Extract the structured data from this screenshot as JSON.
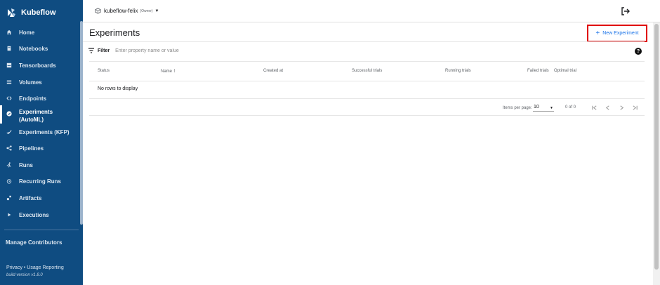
{
  "brand": {
    "name": "Kubeflow"
  },
  "sidebar": {
    "items": [
      {
        "label": "Home",
        "icon": "home-icon"
      },
      {
        "label": "Notebooks",
        "icon": "notebook-icon"
      },
      {
        "label": "Tensorboards",
        "icon": "tensorboard-icon"
      },
      {
        "label": "Volumes",
        "icon": "volume-icon"
      },
      {
        "label": "Endpoints",
        "icon": "endpoints-icon"
      },
      {
        "label": "Experiments\n(AutoML)",
        "icon": "check-circle-icon",
        "active": true
      },
      {
        "label": "Experiments (KFP)",
        "icon": "check-icon"
      },
      {
        "label": "Pipelines",
        "icon": "pipelines-icon"
      },
      {
        "label": "Runs",
        "icon": "runs-icon"
      },
      {
        "label": "Recurring Runs",
        "icon": "alarm-icon"
      },
      {
        "label": "Artifacts",
        "icon": "artifacts-icon"
      },
      {
        "label": "Executions",
        "icon": "play-icon"
      }
    ],
    "manage_contributors": "Manage Contributors",
    "footer_links": "Privacy  •  Usage Reporting",
    "build_version": "build version v1.8.0"
  },
  "topbar": {
    "namespace": "kubeflow-felix",
    "namespace_role": "(Owner)"
  },
  "page": {
    "title": "Experiments",
    "new_button": "New Experiment",
    "filter_label": "Filter",
    "filter_placeholder": "Enter property name or value",
    "columns": [
      "Status",
      "Name",
      "Created at",
      "Successful trials",
      "Running trials",
      "Failed trials",
      "Optimal trial"
    ],
    "empty_message": "No rows to display",
    "items_per_page_label": "Items per page:",
    "items_per_page": "10",
    "range": "0 of 0"
  },
  "colors": {
    "sidebar": "#0f4c81",
    "accent": "#1a73e8",
    "highlight": "#e00000"
  }
}
